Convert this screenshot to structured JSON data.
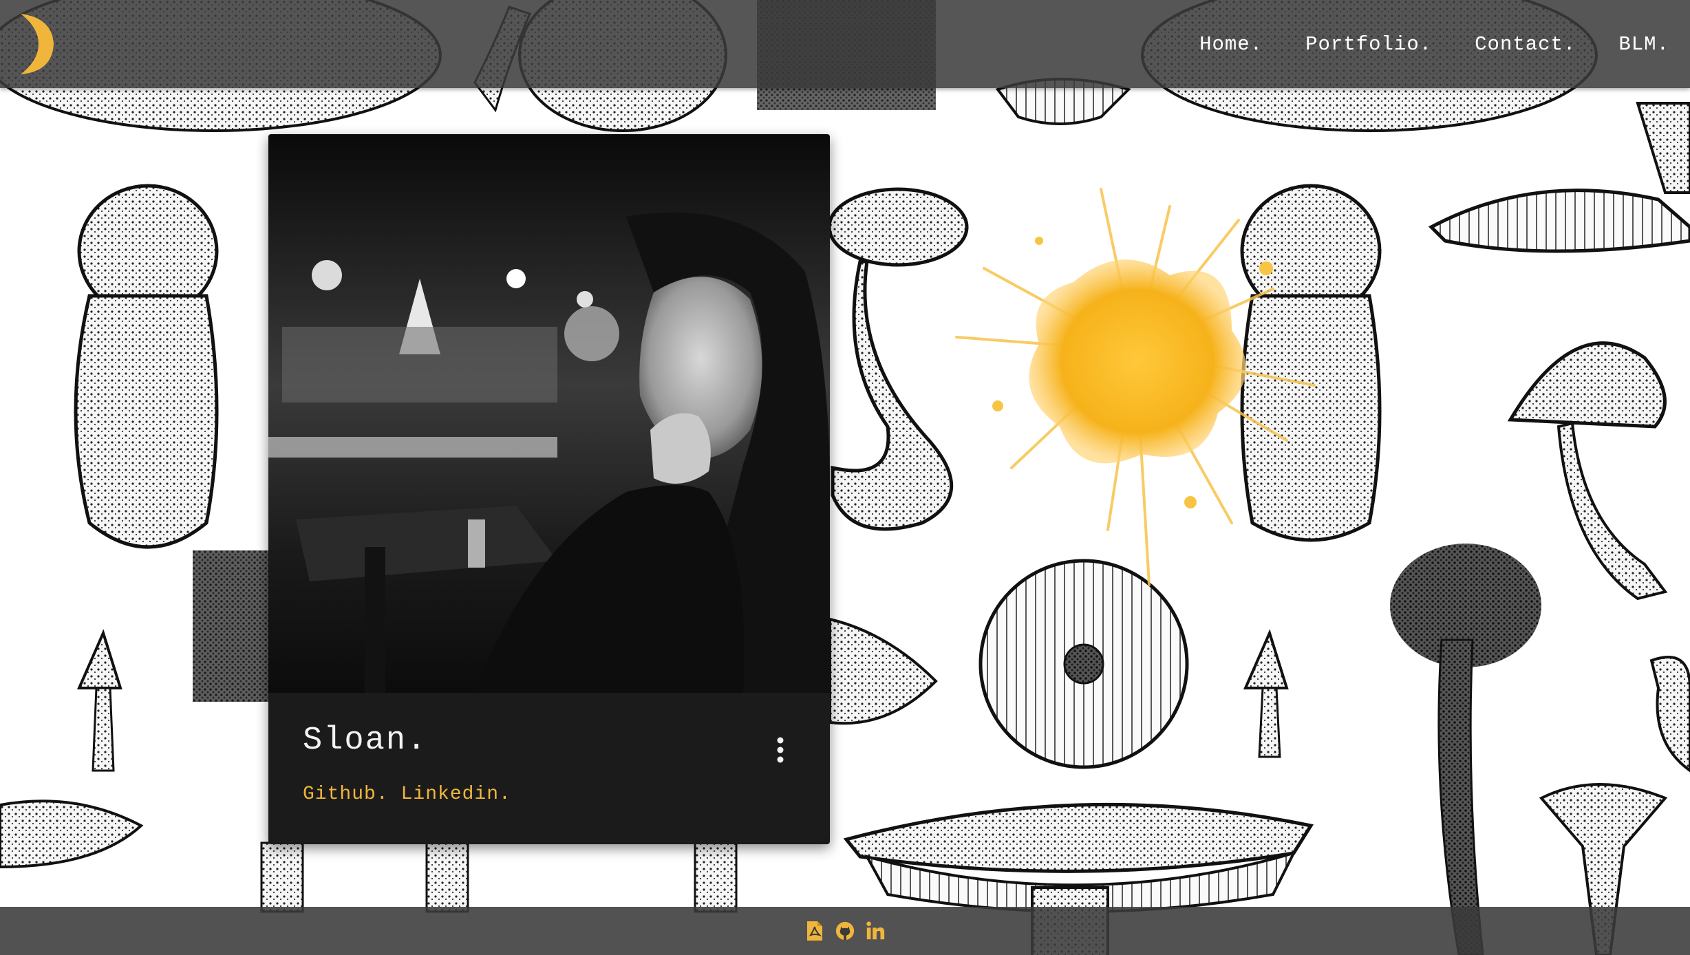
{
  "nav": {
    "logo": "crescent-moon-icon",
    "links": [
      {
        "label": "Home."
      },
      {
        "label": "Portfolio."
      },
      {
        "label": "Contact."
      },
      {
        "label": "BLM."
      }
    ]
  },
  "card": {
    "title": "Sloan.",
    "links": [
      {
        "label": "Github."
      },
      {
        "label": "Linkedin."
      }
    ],
    "menu_icon": "more-vert-icon"
  },
  "footer": {
    "icons": [
      "pdf-file-icon",
      "github-icon",
      "linkedin-icon"
    ]
  },
  "colors": {
    "accent": "#f0b63c",
    "navbar": "#3a3a3a",
    "card": "#1b1b1b",
    "text_light": "#ffffff"
  }
}
